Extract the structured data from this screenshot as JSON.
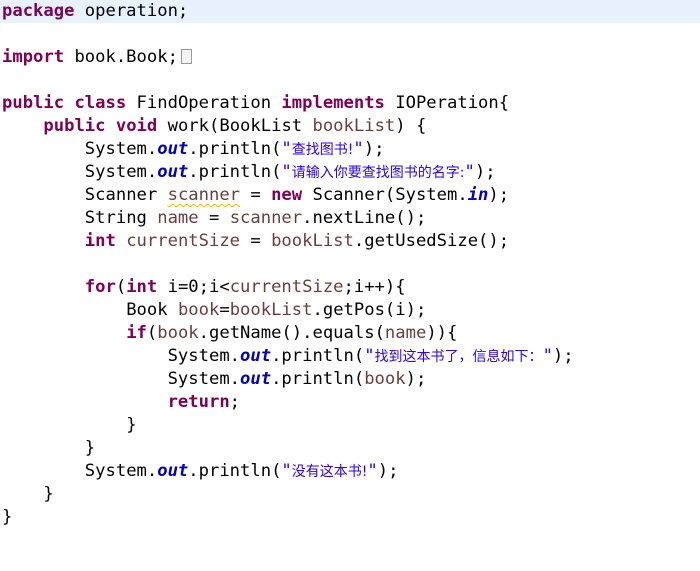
{
  "editor": {
    "theme": {
      "background": "#ffffff",
      "current_line": "#e8f2fe",
      "keyword": "#7f0055",
      "field": "#0000c0",
      "string": "#2a00ff",
      "local_variable": "#6a3e3e",
      "warning_underline": "#f5b800"
    },
    "code": {
      "l1": {
        "kw": "package",
        "rest": " operation;"
      },
      "l3": {
        "kw": "import",
        "rest": " book.Book;",
        "fold_icon": "folded-imports-icon"
      },
      "l5": {
        "kw1": "public",
        "kw2": "class",
        "cls": " FindOperation ",
        "kw3": "implements",
        "rest": " IOPeration{"
      },
      "l6": {
        "kw1": "public",
        "kw2": "void",
        "a": " work(BookList ",
        "param": "bookList",
        "b": ") {"
      },
      "l7": {
        "a": "System.",
        "fld": "out",
        "b": ".println(",
        "q1": "\"",
        "s": "查找图书!",
        "q2": "\"",
        "c": ");"
      },
      "l8": {
        "a": "System.",
        "fld": "out",
        "b": ".println(",
        "q1": "\"",
        "s": "请输入你要查找图书的名字:",
        "q2": "\"",
        "c": ");"
      },
      "l9": {
        "a": "Scanner ",
        "var": "scanner",
        "b": " = ",
        "kw": "new",
        "c": " Scanner(System.",
        "fld": "in",
        "d": ");"
      },
      "l10": {
        "a": "String ",
        "var": "name",
        "b": " = ",
        "var2": "scanner",
        "c": ".nextLine();"
      },
      "l11": {
        "kw": "int",
        "sp": " ",
        "var": "currentSize",
        "b": " = ",
        "var2": "bookList",
        "c": ".getUsedSize();"
      },
      "l13": {
        "kw1": "for",
        "p1": "(",
        "kw2": "int",
        "a": " i=0;i<",
        "var": "currentSize",
        "b": ";i++){"
      },
      "l14": {
        "a": "Book ",
        "var": "book",
        "b": "=",
        "var2": "bookList",
        "c": ".getPos(i);"
      },
      "l15": {
        "kw": "if",
        "p1": "(",
        "var": "book",
        "a": ".getName().equals(",
        "var2": "name",
        "b": ")){"
      },
      "l16": {
        "a": "System.",
        "fld": "out",
        "b": ".println(",
        "q1": "\"",
        "s": "找到这本书了，信息如下：",
        "q2": "\"",
        "c": ");"
      },
      "l17": {
        "a": "System.",
        "fld": "out",
        "b": ".println(",
        "var": "book",
        "c": ");"
      },
      "l18": {
        "kw": "return",
        "rest": ";"
      },
      "l19": {
        "rest": "}"
      },
      "l20": {
        "rest": "}"
      },
      "l21": {
        "a": "System.",
        "fld": "out",
        "b": ".println(",
        "q1": "\"",
        "s": "没有这本书!",
        "q2": "\"",
        "c": ");"
      },
      "l22": {
        "rest": "}"
      },
      "l23": {
        "rest": "}"
      }
    }
  }
}
